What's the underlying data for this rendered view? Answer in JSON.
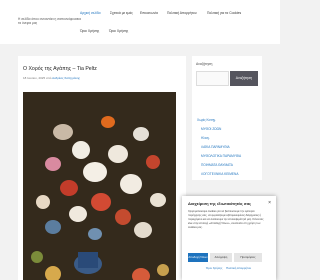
{
  "header": {
    "tagline": "Η σελίδα όπου συναντάει η σαπουνόφουσκα τα όνειρα μας",
    "nav": [
      "Αρχική σελίδα",
      "Σχετικά με εμάς",
      "Επικοινωνία",
      "Πολιτική Απορρήτου",
      "Πολιτική για τα Cookies",
      "Όροι Χρήσης",
      "Όροι Χρήσης"
    ]
  },
  "article": {
    "title": "Ο Χορός της Αγάπης – Tia Peltz",
    "date": "18 Ιουλίου, 2025 από",
    "author": "Ανδρέας Χατζηγάκης"
  },
  "sidebar": {
    "search_label": "Αναζήτηση",
    "search_button": "Αναζήτηση",
    "categories": [
      "Χωρίς Κατηγ.",
      "ΜΥΘΟΙ ΖΩΩΝ",
      "Ηλιογ.",
      "ΛΑΪΚΑ ΠΑΡΑΜΥΘΙΑ",
      "ΜΥΘΟΛΟΓΙΚΑ ΠΑΡΑΜΥΘΙΑ",
      "ΠΟΙΗΜΑΤΑ ΘΑΥΜΑΤΑ",
      "ΛΟΓΟΤΕΧΝΙΚΑ ΚΕΙΜΕΝΑ"
    ]
  },
  "cookie": {
    "title": "Διαχείριση της ιδιωτικότητάς σας",
    "text": "Χρησιμοποιούμε cookies για να βελτιώσουμε την εμπειρία περιήγησης σας, να εμφανίζουμε εξατομικευμένες διαφημίσεις ή περιεχόμενο και να αναλύουμε την επισκεψιμότητά μας. Κάνοντας κλικ στην επιλογή «Αποδοχή Όλων», συναινείτε στη χρήση των cookies μας.",
    "accept": "Αποδοχή Όλων",
    "deny": "Απόρριψη",
    "prefs": "Προτιμήσεις",
    "links": [
      "Όροι Χρήσης",
      "Πολιτική Απορρήτου"
    ]
  },
  "colors": {
    "link": "#1e73be",
    "search_button_bg": "#55555e",
    "page_bg": "#f2f2f2"
  }
}
